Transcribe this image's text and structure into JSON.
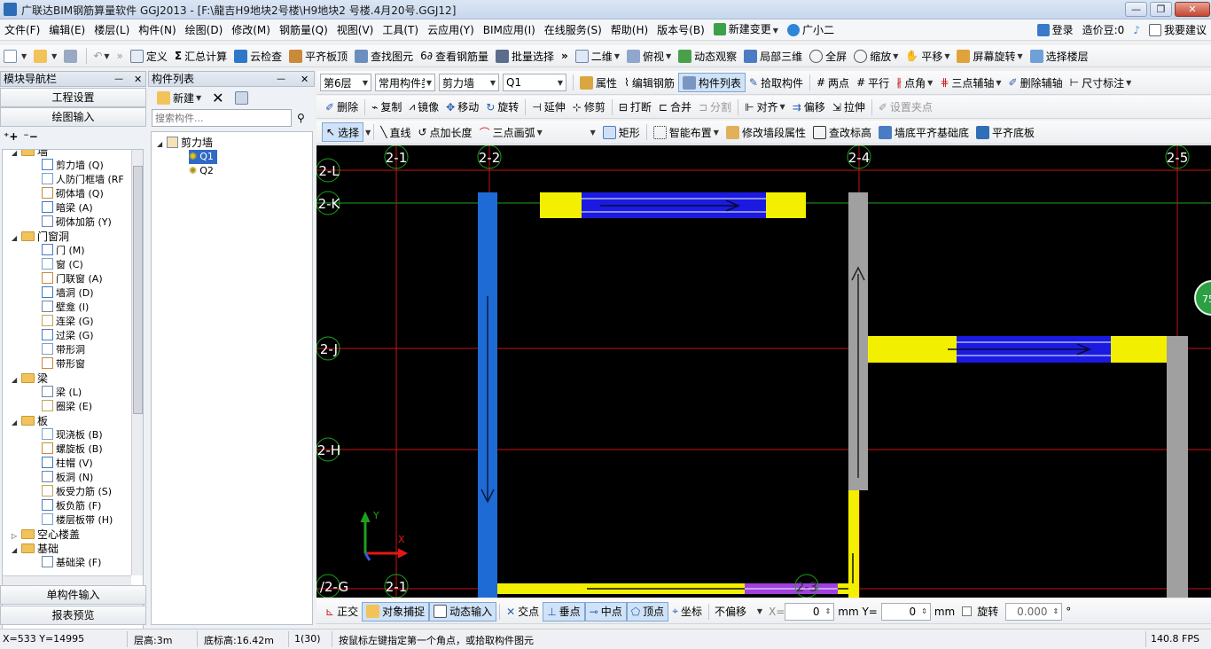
{
  "window": {
    "title": "广联达BIM钢筋算量软件 GGJ2013 - [F:\\龍吉H9地块2号楼\\H9地块2 号楼.4月20号.GGJ12]",
    "min": "—",
    "max": "❐",
    "close": "✕"
  },
  "menu": {
    "items": [
      "文件(F)",
      "编辑(E)",
      "楼层(L)",
      "构件(N)",
      "绘图(D)",
      "修改(M)",
      "钢筋量(Q)",
      "视图(V)",
      "工具(T)",
      "云应用(Y)",
      "BIM应用(I)",
      "在线服务(S)",
      "帮助(H)",
      "版本号(B)"
    ],
    "new_change": "新建变更",
    "assistant": "广小二",
    "login": "登录",
    "price_beans": "造价豆:0",
    "suggest": "我要建议"
  },
  "toolbar1": {
    "define": "定义",
    "sum_calc": "汇总计算",
    "cloud_check": "云检查",
    "flush_top": "平齐板顶",
    "find_element": "查找图元",
    "view_rebar": "查看钢筋量",
    "batch_select": "批量选择",
    "view_2d": "二维",
    "view_top": "俯视",
    "dynamic_view": "动态观察",
    "local_3d": "局部三维",
    "fullscreen": "全屏",
    "zoom": "缩放",
    "pan": "平移",
    "screen_rotate": "屏幕旋转",
    "select_floor": "选择楼层"
  },
  "toolbar2": {
    "floor": "第6层",
    "category": "常用构件类",
    "type": "剪力墙",
    "component": "Q1",
    "properties": "属性",
    "edit_rebar": "编辑钢筋",
    "component_list": "构件列表",
    "pick_component": "拾取构件",
    "two_points": "两点",
    "parallel": "平行",
    "point_angle": "点角",
    "three_point_aux": "三点辅轴",
    "delete_aux": "删除辅轴",
    "dimension": "尺寸标注"
  },
  "toolbar3": {
    "delete": "删除",
    "copy": "复制",
    "mirror": "镜像",
    "move": "移动",
    "rotate": "旋转",
    "extend": "延伸",
    "trim": "修剪",
    "break": "打断",
    "merge": "合并",
    "split": "分割",
    "align": "对齐",
    "offset": "偏移",
    "stretch": "拉伸",
    "set_grip": "设置夹点"
  },
  "toolbar4": {
    "select": "选择",
    "line": "直线",
    "point_length": "点加长度",
    "three_point_arc": "三点画弧",
    "rectangle": "矩形",
    "smart_layout": "智能布置",
    "modify_segment": "修改墙段属性",
    "modify_elevation": "查改标高",
    "wall_base_flush": "墙底平齐基础底",
    "flush_bottom": "平齐底板"
  },
  "left_nav": {
    "title": "模块导航栏",
    "project_settings": "工程设置",
    "draw_input": "绘图输入",
    "single_input": "单构件输入",
    "report_preview": "报表预览",
    "tree": [
      {
        "label": "墙",
        "group": true
      },
      {
        "label": "剪力墙 (Q)"
      },
      {
        "label": "人防门框墙 (RF"
      },
      {
        "label": "砌体墙 (Q)"
      },
      {
        "label": "暗梁 (A)"
      },
      {
        "label": "砌体加筋 (Y)"
      },
      {
        "label": "门窗洞",
        "group": true
      },
      {
        "label": "门 (M)"
      },
      {
        "label": "窗 (C)"
      },
      {
        "label": "门联窗 (A)"
      },
      {
        "label": "墙洞 (D)"
      },
      {
        "label": "壁龛 (I)"
      },
      {
        "label": "连梁 (G)"
      },
      {
        "label": "过梁 (G)"
      },
      {
        "label": "带形洞"
      },
      {
        "label": "带形窗"
      },
      {
        "label": "梁",
        "group": true
      },
      {
        "label": "梁 (L)"
      },
      {
        "label": "圈梁 (E)"
      },
      {
        "label": "板",
        "group": true
      },
      {
        "label": "现浇板 (B)"
      },
      {
        "label": "螺旋板 (B)"
      },
      {
        "label": "柱帽 (V)"
      },
      {
        "label": "板洞 (N)"
      },
      {
        "label": "板受力筋 (S)"
      },
      {
        "label": "板负筋 (F)"
      },
      {
        "label": "楼层板带 (H)"
      },
      {
        "label": "空心楼盖",
        "group": true,
        "collapsed": true
      },
      {
        "label": "基础",
        "group": true
      },
      {
        "label": "基础梁 (F)"
      }
    ]
  },
  "component_list": {
    "title": "构件列表",
    "new": "新建",
    "search_placeholder": "搜索构件...",
    "root": "剪力墙",
    "items": [
      "Q1",
      "Q2"
    ]
  },
  "canvas": {
    "axes_top": [
      "2-1",
      "2-2",
      "2-4",
      "2-5"
    ],
    "axes_left": [
      "2-L",
      "2-K",
      "2-J",
      "2-H",
      "/2-G"
    ],
    "axis_bottom_label": "2-1",
    "axis_bottom_label2": "2-3",
    "ucs_x": "X",
    "ucs_y": "Y",
    "badge": "75"
  },
  "snapbar": {
    "ortho": "正交",
    "object_snap": "对象捕捉",
    "dynamic_input": "动态输入",
    "intersection": "交点",
    "perpendicular": "垂点",
    "midpoint": "中点",
    "vertex": "顶点",
    "coordinate": "坐标",
    "offset_mode": "不偏移",
    "x_label": "X=",
    "x_value": "0",
    "y_label": "mm  Y=",
    "y_value": "0",
    "mm": "mm",
    "rotate_label": "旋转",
    "rotate_value": "0.000",
    "deg": "°"
  },
  "status": {
    "coords": "X=533 Y=14995",
    "floor_height": "层高:3m",
    "base_elev": "底标高:16.42m",
    "count": "1(30)",
    "hint": "按鼠标左键指定第一个角点，或拾取构件图元",
    "fps": "140.8 FPS"
  },
  "colors": {
    "canvas_bg": "#000000",
    "grid_red": "#c81414",
    "grid_green": "#1ea01e",
    "wall_blue": "#1e6bd6",
    "wall_yellow": "#f2f000",
    "wall_gray": "#a0a0a0",
    "rebar_blue": "#1a1ae0"
  }
}
